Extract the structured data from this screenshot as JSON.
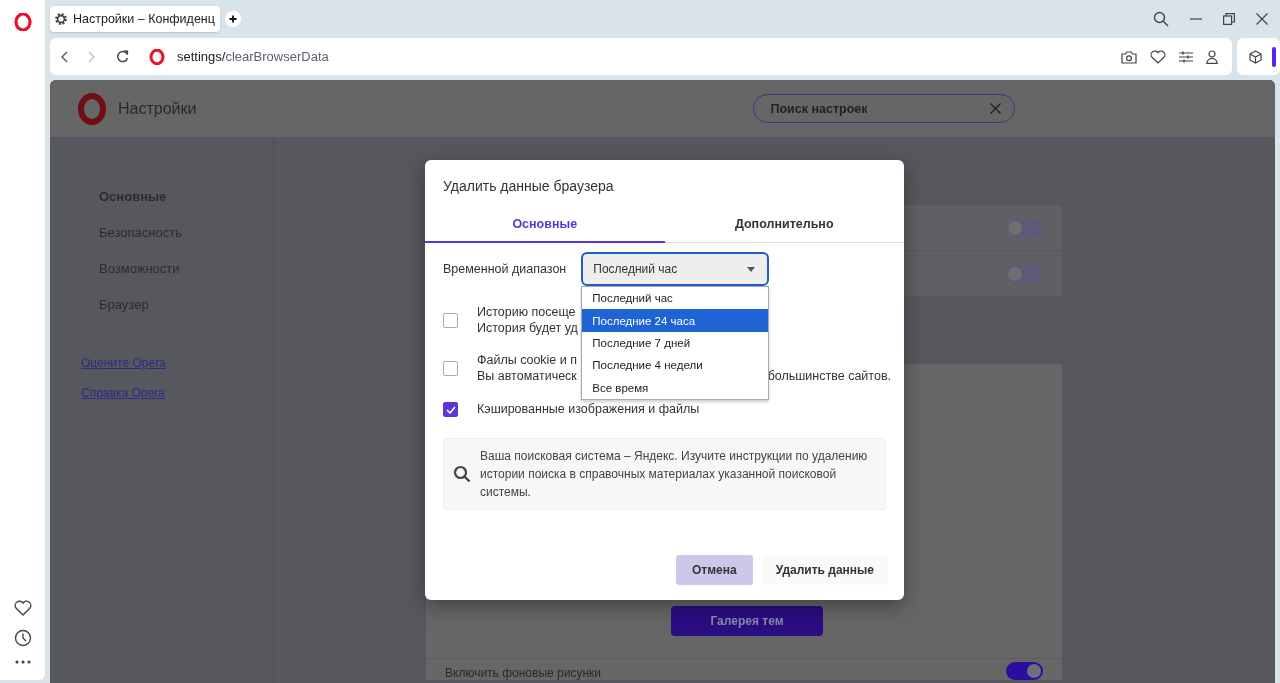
{
  "browser": {
    "tab": {
      "title": "Настройки – Конфиденц"
    },
    "address": {
      "host": "settings/",
      "path": "clearBrowserData"
    }
  },
  "settings": {
    "title": "Настройки",
    "search": {
      "placeholder": "Поиск настроек"
    },
    "sidebar": {
      "items": [
        {
          "label": "Основные",
          "selected": true
        },
        {
          "label": "Безопасность",
          "selected": false
        },
        {
          "label": "Возможности",
          "selected": false
        },
        {
          "label": "Браузер",
          "selected": false
        }
      ],
      "links": [
        "Оцените Opera",
        "Справка Opera"
      ]
    },
    "toggles": [
      {
        "on": false
      },
      {
        "on": false
      }
    ],
    "theme_button": "Галерея тем",
    "wallpaper_row": {
      "label": "Включить фоновые рисунки",
      "on": true
    }
  },
  "dialog": {
    "title": "Удалить данные браузера",
    "tabs": [
      {
        "label": "Основные",
        "selected": true
      },
      {
        "label": "Дополнительно",
        "selected": false
      }
    ],
    "time_range": {
      "label": "Временной диапазон",
      "value": "Последний час",
      "expanded": true,
      "options": [
        {
          "label": "Последний час",
          "highlighted": false
        },
        {
          "label": "Последние 24 часа",
          "highlighted": true
        },
        {
          "label": "Последние 7 дней",
          "highlighted": false
        },
        {
          "label": "Последние 4 недели",
          "highlighted": false
        },
        {
          "label": "Все время",
          "highlighted": false
        }
      ]
    },
    "items": [
      {
        "checked": false,
        "lines": [
          [
            "Историю посеще"
          ],
          [
            "История будет уд"
          ]
        ]
      },
      {
        "checked": false,
        "lines": [
          [
            "Файлы cookie и п"
          ],
          [
            "Вы автоматическ",
            "большинстве сайтов."
          ]
        ]
      },
      {
        "checked": true,
        "lines": [
          [
            "Кэшированные изображения и файлы"
          ]
        ]
      }
    ],
    "notice": "Ваша поисковая система – Яндекс. Изучите инструкции по удалению истории поиска в справочных материалах указанной поисковой системы.",
    "buttons": [
      {
        "label": "Отмена",
        "kind": "highlighted"
      },
      {
        "label": "Удалить данные",
        "kind": "plain"
      }
    ]
  }
}
